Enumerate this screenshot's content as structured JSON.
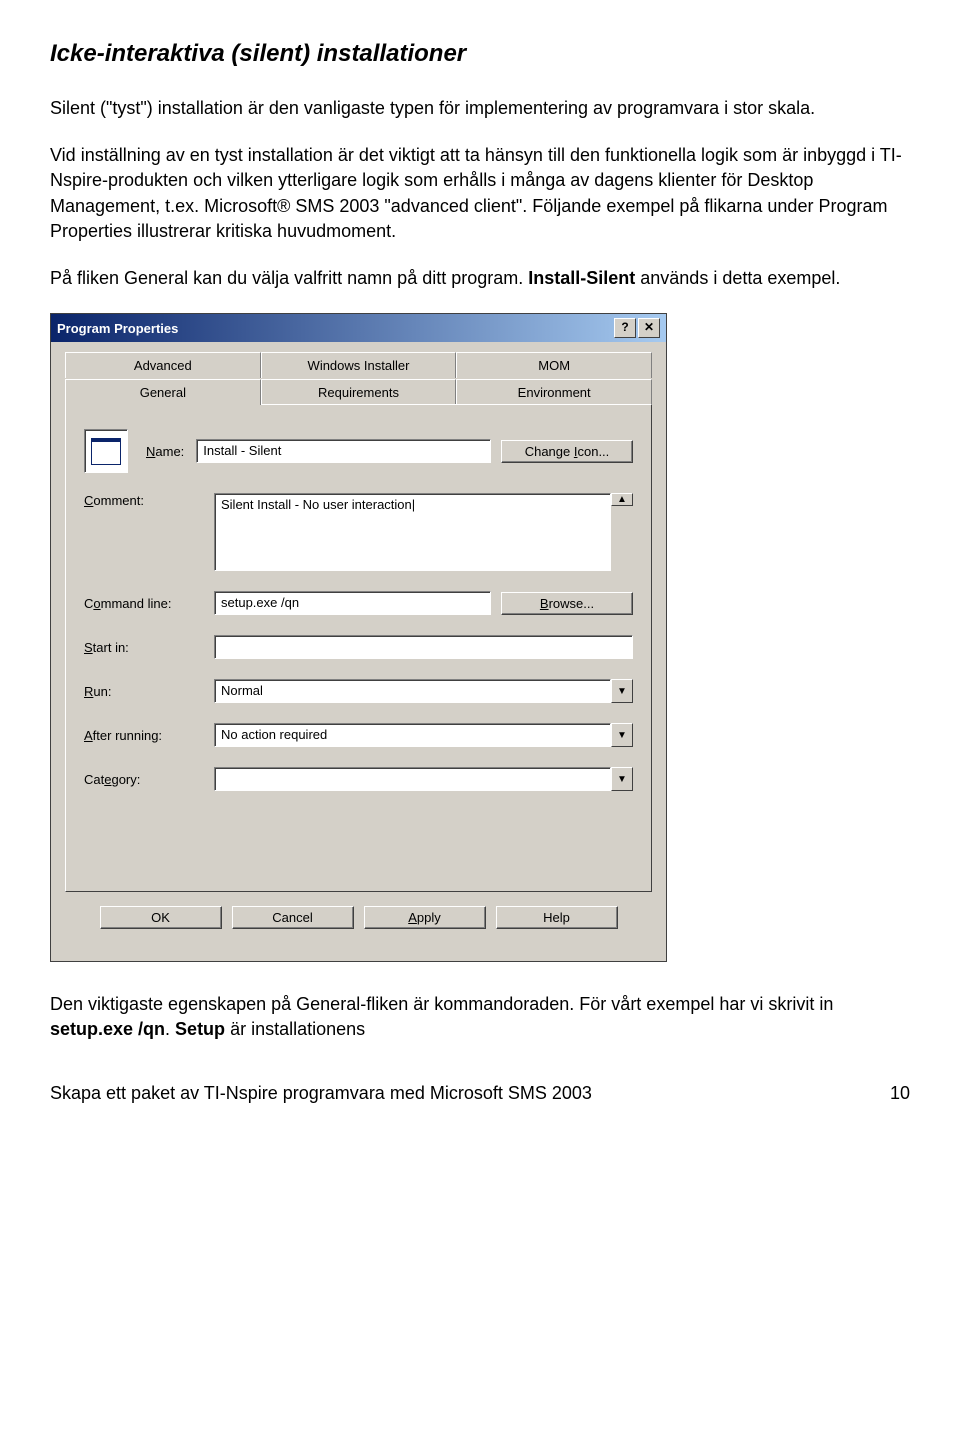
{
  "doc": {
    "heading": "Icke-interaktiva (silent) installationer",
    "p1": "Silent (\"tyst\") installation är den vanligaste typen för implementering av programvara i stor skala.",
    "p2": "Vid inställning av en tyst installation är det viktigt att ta hänsyn till den funktionella logik som är inbyggd i TI-Nspire-produkten och vilken ytterligare logik som erhålls i många av dagens klienter för Desktop Management, t.ex. Microsoft® SMS 2003 \"advanced client\". Följande exempel på flikarna under Program Properties illustrerar kritiska huvudmoment.",
    "p3_a": "På fliken General kan du välja valfritt namn på ditt program. ",
    "p3_b": "Install-Silent",
    "p3_c": " används i detta exempel.",
    "p4_a": "Den viktigaste egenskapen på General-fliken är kommandoraden. För vårt exempel har vi skrivit in ",
    "p4_b": "setup.exe /qn",
    "p4_c": ". ",
    "p4_d": "Setup",
    "p4_e": " är installationens",
    "footer_left": "Skapa ett paket av TI-Nspire programvara med Microsoft SMS 2003",
    "footer_right": "10"
  },
  "dialog": {
    "title": "Program Properties",
    "help_btn": "?",
    "close_btn": "✕",
    "tabs_back": [
      "Advanced",
      "Windows Installer",
      "MOM"
    ],
    "tabs_front": [
      "General",
      "Requirements",
      "Environment"
    ],
    "labels": {
      "name": "Name:",
      "comment": "Comment:",
      "cmdline": "Command line:",
      "startin": "Start in:",
      "run": "Run:",
      "after": "After running:",
      "category": "Category:"
    },
    "values": {
      "name": "Install - Silent",
      "comment": "Silent Install - No user interaction",
      "cmdline": "setup.exe /qn",
      "startin": "",
      "run": "Normal",
      "after": "No action required",
      "category": ""
    },
    "buttons": {
      "change_icon": "Change Icon...",
      "browse": "Browse...",
      "ok": "OK",
      "cancel": "Cancel",
      "apply": "Apply",
      "help": "Help"
    }
  }
}
